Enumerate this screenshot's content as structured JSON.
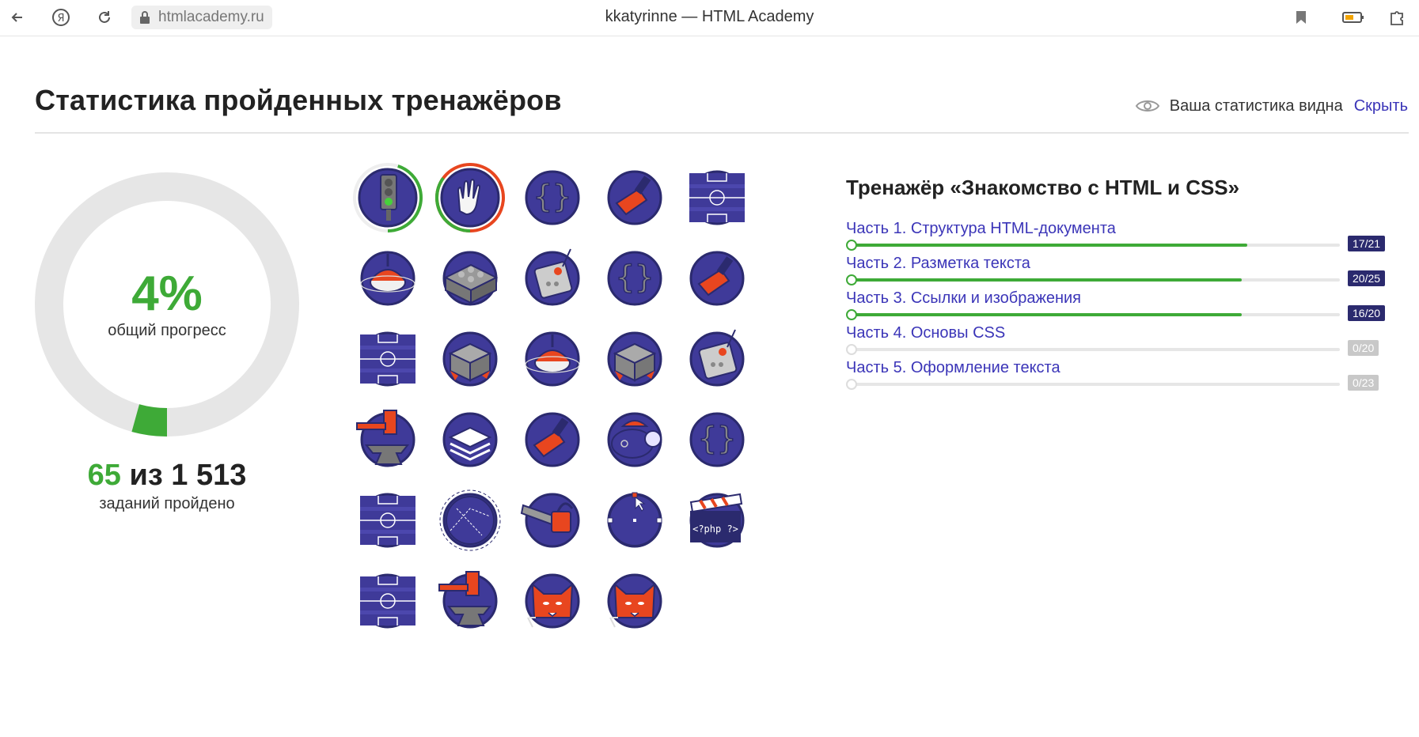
{
  "browser": {
    "url": "htmlacademy.ru",
    "title": "kkatyrinne — HTML Academy"
  },
  "header": {
    "title": "Статистика пройденных тренажёров",
    "visibility_text": "Ваша статистика видна",
    "hide_label": "Скрыть"
  },
  "progress": {
    "percent": "4%",
    "percent_label": "общий прогресс",
    "completed": "65",
    "separator": "из",
    "total": "1 513",
    "count_label": "заданий пройдено",
    "fraction": 0.043
  },
  "badges": [
    {
      "icon": "traffic-light-icon",
      "progress": 0.45
    },
    {
      "icon": "palm-hand-icon",
      "progress": 1.0
    },
    {
      "icon": "curly-braces-icon"
    },
    {
      "icon": "paint-brush-icon"
    },
    {
      "icon": "football-field-icon"
    },
    {
      "icon": "spinning-top-icon"
    },
    {
      "icon": "lego-brick-icon"
    },
    {
      "icon": "remote-control-icon"
    },
    {
      "icon": "curly-braces-icon"
    },
    {
      "icon": "paint-brush-icon"
    },
    {
      "icon": "football-field-icon"
    },
    {
      "icon": "rubik-cube-icon"
    },
    {
      "icon": "spinning-top-icon"
    },
    {
      "icon": "rubik-cube-icon"
    },
    {
      "icon": "remote-control-icon"
    },
    {
      "icon": "anvil-icon"
    },
    {
      "icon": "layers-icon"
    },
    {
      "icon": "paint-brush-icon"
    },
    {
      "icon": "submarine-icon"
    },
    {
      "icon": "curly-braces-icon"
    },
    {
      "icon": "football-field-icon"
    },
    {
      "icon": "planet-icon"
    },
    {
      "icon": "chainsaw-icon"
    },
    {
      "icon": "bezier-path-icon"
    },
    {
      "icon": "php-clapperboard-icon"
    },
    {
      "icon": "football-field-icon"
    },
    {
      "icon": "anvil-icon"
    },
    {
      "icon": "fox-icon"
    },
    {
      "icon": "fox-icon"
    }
  ],
  "trainer": {
    "title": "Тренажёр «Знакомство с HTML и CSS»",
    "parts": [
      {
        "label": "Часть 1. Структура HTML-документа",
        "done": 17,
        "total": 21,
        "tag": "17/21"
      },
      {
        "label": "Часть 2. Разметка текста",
        "done": 20,
        "total": 25,
        "tag": "20/25"
      },
      {
        "label": "Часть 3. Ссылки и изображения",
        "done": 16,
        "total": 20,
        "tag": "16/20"
      },
      {
        "label": "Часть 4. Основы CSS",
        "done": 0,
        "total": 20,
        "tag": "0/20"
      },
      {
        "label": "Часть 5. Оформление текста",
        "done": 0,
        "total": 23,
        "tag": "0/23"
      }
    ]
  },
  "colors": {
    "accent_green": "#3eaa37",
    "link_purple": "#3b35b8",
    "badge_bg": "#3f3a99",
    "badge_orange": "#e8461f",
    "ring_gray": "#e6e6e6"
  }
}
